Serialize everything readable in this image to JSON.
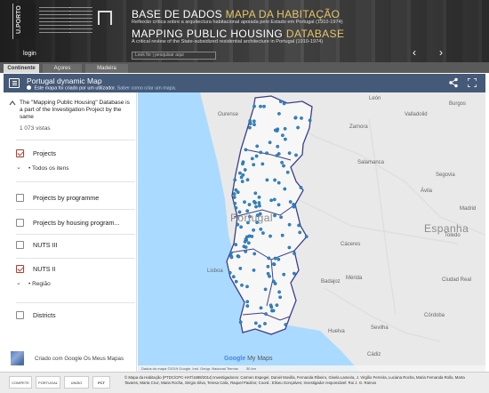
{
  "header": {
    "logo_text": "U.PORTO",
    "login": "login",
    "title1_main": "BASE DE DADOS",
    "title1_accent": "MAPA DA HABITAÇÃO",
    "subtitle1": "Reflexão crítica sobre a arquitectura habitacional apoiada pelo Estado em Portugal (1910-1974)",
    "title2_main": "MAPPING PUBLIC HOUSING",
    "title2_accent": "DATABASE",
    "subtitle2": "A critical review of the State-subsidized residential architecture in Portugal (1910-1974)",
    "search_placeholder": "Look for | pesquisar aqui",
    "prev_arrow": "‹",
    "next_arrow": "›"
  },
  "tabs": [
    "Continente",
    "Açores",
    "Madeira"
  ],
  "map_bar": {
    "title": "Portugal dynamic Map",
    "info_text": "Este mapa foi criado por um utilizador.",
    "info_link": "Saber como criar um mapa."
  },
  "panel": {
    "description": "The \"Mapping Public Housing\" Database is a part of the Investigation Project by the same",
    "views": "1 073 vistas",
    "layers": [
      {
        "label": "Projects",
        "checked": true,
        "sub": "Todos os itens"
      },
      {
        "label": "Projects by programme",
        "checked": false
      },
      {
        "label": "Projects by housing program...",
        "checked": false
      },
      {
        "label": "NUTS III",
        "checked": false
      },
      {
        "label": "NUTS II",
        "checked": true,
        "sub": "Região"
      },
      {
        "label": "Districts",
        "checked": false
      }
    ],
    "footer": "Criado com Google Os Meus Mapas"
  },
  "map": {
    "labels": {
      "portugal": "Portugal",
      "espanha": "Espanha",
      "valladolid": "Valladolid",
      "salamanca": "Salamanca",
      "leon": "León",
      "burgos": "Burgos",
      "segovia": "Segovia",
      "madrid": "Madrid",
      "toledo": "Toledo",
      "caceres": "Cáceres",
      "badajoz": "Badajoz",
      "merida": "Mérida",
      "cordoba": "Córdoba",
      "sevilha": "Sevilha",
      "huelva": "Huelva",
      "cadiz": "Cádiz",
      "ciudad_real": "Ciudad Real",
      "avila": "Ávila",
      "zamora": "Zamora",
      "ourense": "Ourense",
      "lisboa": "Lisboa"
    },
    "google": "Google",
    "google_suffix": " My Maps",
    "scale": "50 km",
    "attribution": "Dados do mapa ©2019 Google, Inst. Geogr. Nacional   Termos"
  },
  "footer": {
    "sponsors": [
      "COMPETE 2020",
      "PORTUGAL 2020",
      "UNIÃO EUROPEIA",
      "FCT"
    ],
    "credits": "© Mapa da Habitação (PTDC/CPC-HAT/1688/2014) Investigadores: Carmen Espegel, Daniel Movilla, Fernanda Ribeiro, Gisela Lameira, J. Virgílio Ferreira, Luciana Rocha, Maria Fernanda Rollo, Marta Tavares, Marta Cruz, Maria Rocha, Sérgio Silva, Teresa Calix, Raquel Paulino; Coord.: Eliseu Gonçalves; Investigador responsável: Rui J. G. Ramos"
  },
  "colors": {
    "header_bg": "#2f2f2f",
    "accent": "#e6c66a",
    "map_bar": "#455a78",
    "checkbox_checked": "#c9372c",
    "sea": "#aadaff",
    "land": "#e8e8e8",
    "portugal": "#f7f7f7",
    "region_border": "#3c3f8c",
    "pin": "#2f86c8"
  }
}
